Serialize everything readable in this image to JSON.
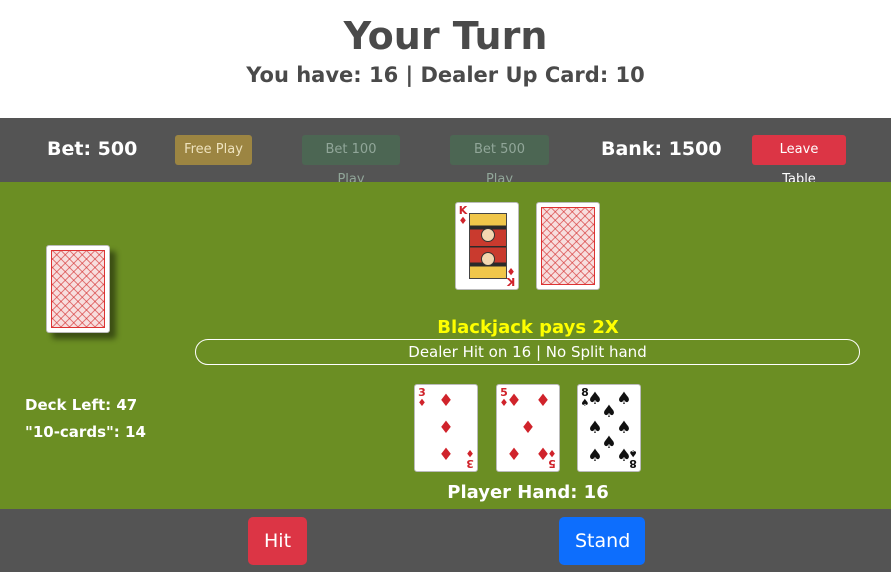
{
  "header": {
    "title": "Your Turn",
    "subtitle": "You have: 16 | Dealer Up Card: 10"
  },
  "topbar": {
    "bet": "Bet: 500",
    "bank": "Bank: 1500",
    "buttons": {
      "free_play": "Free Play",
      "bet100": "Bet 100 Play",
      "bet500": "Bet 500 Play",
      "leave": "Leave Table"
    }
  },
  "colors": {
    "table_felt": "#6b8e23",
    "bar": "#545454",
    "free_play_bg": "#9c8542",
    "bet_disabled_bg": "#4c6653",
    "leave_bg": "#dc3545",
    "hit_bg": "#dc3545",
    "stand_bg": "#0d6efd",
    "pays_text": "#ffff00"
  },
  "dealer": {
    "cards": [
      {
        "rank": "K",
        "suit": "♦",
        "face_up": true
      },
      {
        "face_up": false
      }
    ]
  },
  "table": {
    "pays": "Blackjack pays 2X",
    "rules": "Dealer Hit on 16 | No Split hand",
    "deck_left": "Deck Left: 47",
    "ten_cards": "\"10-cards\": 14",
    "player_hand_label": "Player Hand: 16"
  },
  "player": {
    "cards": [
      {
        "rank": "3",
        "suit": "♦"
      },
      {
        "rank": "5",
        "suit": "♦"
      },
      {
        "rank": "8",
        "suit": "♠"
      }
    ]
  },
  "actions": {
    "hit": "Hit",
    "stand": "Stand"
  }
}
